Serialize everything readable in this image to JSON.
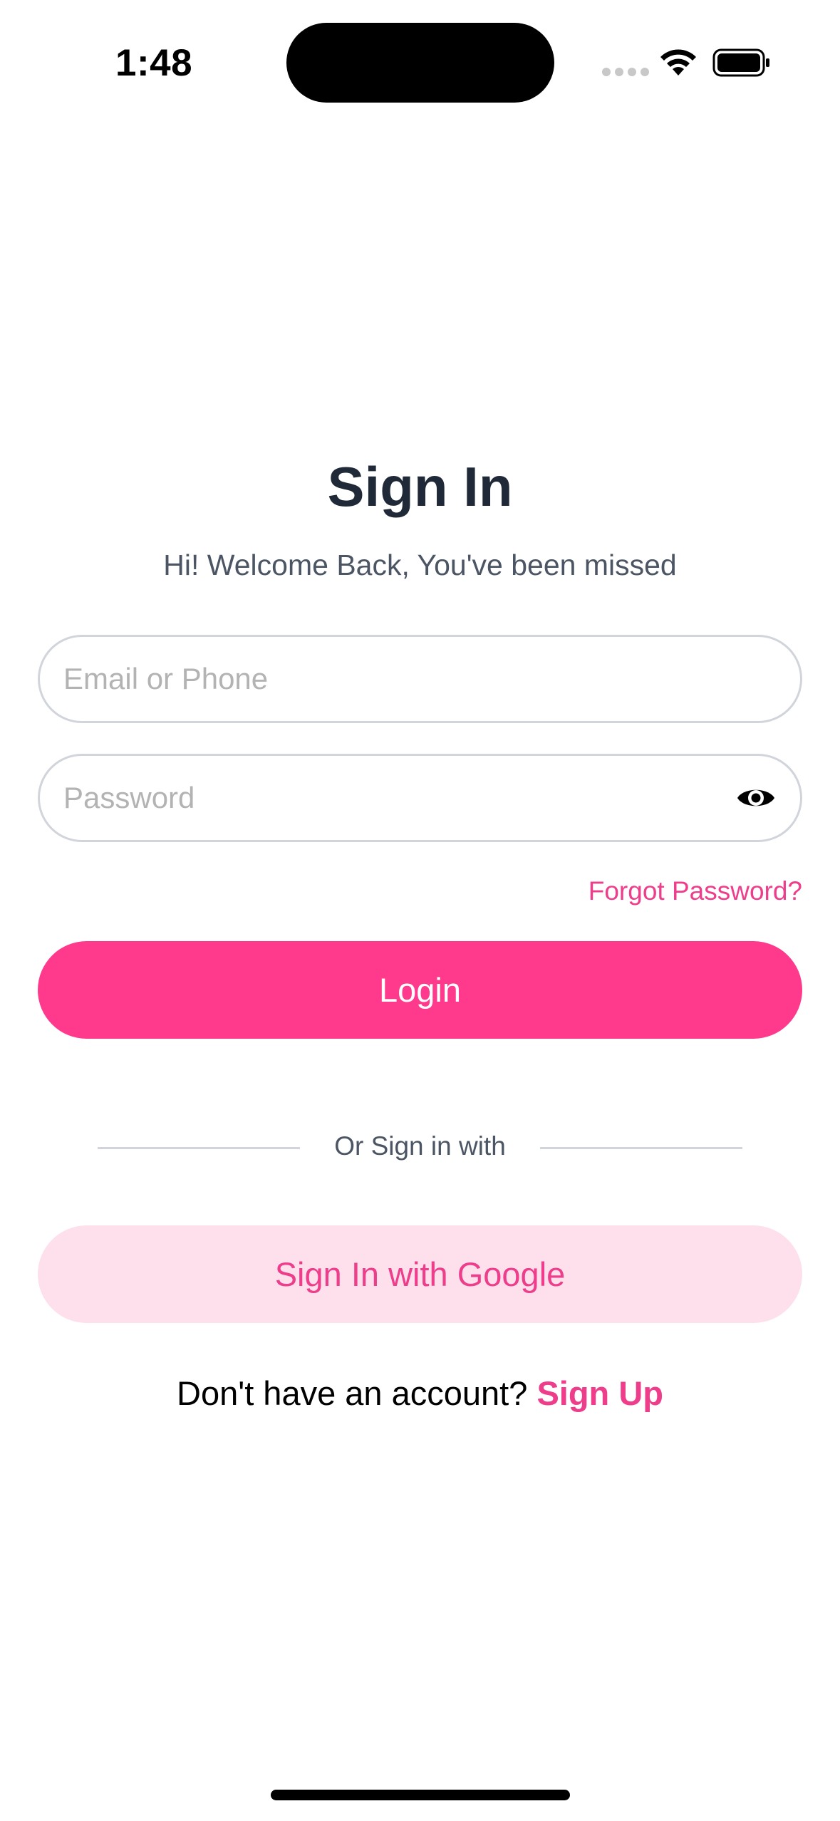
{
  "status_bar": {
    "time": "1:48"
  },
  "screen": {
    "title": "Sign In",
    "subtitle": "Hi! Welcome Back, You've been missed"
  },
  "form": {
    "email_placeholder": "Email or Phone",
    "email_value": "",
    "password_placeholder": "Password",
    "password_value": "",
    "forgot_label": "Forgot Password?",
    "login_label": "Login"
  },
  "divider": {
    "label": "Or Sign in with"
  },
  "social": {
    "google_label": "Sign In with Google"
  },
  "footer": {
    "prompt": "Don't have an account?",
    "signup_label": "Sign Up"
  },
  "icons": {
    "password_toggle": "eye-icon",
    "wifi": "wifi-icon",
    "battery": "battery-icon",
    "signal": "cellular-signal-icon"
  },
  "colors": {
    "accent": "#ff3a8c",
    "accent_text": "#ee3d8b",
    "accent_soft": "#fde0ec",
    "heading": "#1f2937",
    "muted": "#4b5563",
    "border": "#d1d5db"
  }
}
